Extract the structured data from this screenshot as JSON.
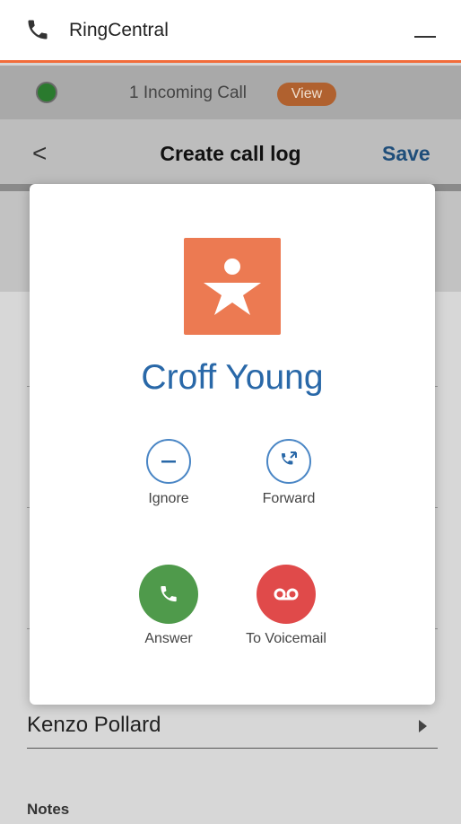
{
  "titlebar": {
    "app_title": "RingCentral"
  },
  "incoming": {
    "text": "1 Incoming Call",
    "view_label": "View"
  },
  "header": {
    "back": "<",
    "title": "Create call log",
    "save_label": "Save"
  },
  "form": {
    "contact_name": "Kenzo Pollard",
    "notes_label": "Notes"
  },
  "modal": {
    "caller_name": "Croff Young",
    "actions": {
      "ignore": "Ignore",
      "forward": "Forward",
      "answer": "Answer",
      "voicemail": "To Voicemail"
    }
  },
  "colors": {
    "brand_orange": "#f26c3a",
    "caller_blue": "#2968a8",
    "answer_green": "#4f9a4b",
    "voicemail_red": "#e04a4a",
    "avatar_bg": "#ec7a52"
  },
  "icons": {
    "phone": "phone-icon",
    "minimize": "minimize-icon",
    "status": "status-dot-icon",
    "back": "chevron-left-icon",
    "avatar": "person-star-icon",
    "ignore": "minus-icon",
    "forward": "phone-forward-icon",
    "answer": "phone-icon",
    "voicemail": "voicemail-icon",
    "contact_caret": "caret-right-icon"
  }
}
